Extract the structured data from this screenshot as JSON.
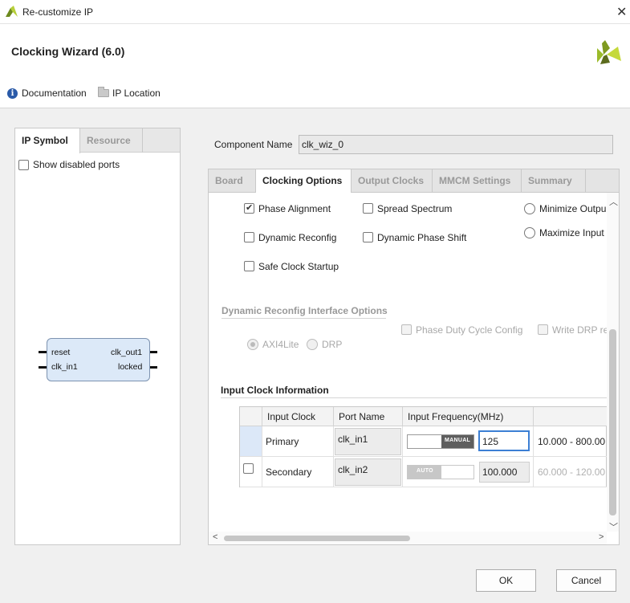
{
  "window": {
    "title": "Re-customize IP",
    "close_glyph": "✕"
  },
  "header": {
    "title": "Clocking Wizard (6.0)",
    "documentation_label": "Documentation",
    "ip_location_label": "IP Location"
  },
  "left_panel": {
    "tabs": [
      {
        "label": "IP Symbol",
        "active": true
      },
      {
        "label": "Resource",
        "active": false
      }
    ],
    "show_disabled_ports": {
      "label": "Show disabled ports",
      "checked": false
    },
    "symbol": {
      "left_ports": [
        "reset",
        "clk_in1"
      ],
      "right_ports": [
        "clk_out1",
        "locked"
      ]
    }
  },
  "component": {
    "label": "Component Name",
    "value": "clk_wiz_0"
  },
  "tabs": [
    {
      "label": "Board",
      "active": false
    },
    {
      "label": "Clocking Options",
      "active": true
    },
    {
      "label": "Output Clocks",
      "active": false
    },
    {
      "label": "MMCM Settings",
      "active": false
    },
    {
      "label": "Summary",
      "active": false
    }
  ],
  "clocking_options": {
    "phase_alignment": {
      "label": "Phase Alignment",
      "checked": true
    },
    "spread_spectrum": {
      "label": "Spread Spectrum",
      "checked": false
    },
    "minimize_output": {
      "label": "Minimize Outpu",
      "selected": false
    },
    "dynamic_reconfig": {
      "label": "Dynamic Reconfig",
      "checked": false
    },
    "dynamic_phase_shift": {
      "label": "Dynamic Phase Shift",
      "checked": false
    },
    "maximize_input": {
      "label": "Maximize Input",
      "selected": false
    },
    "safe_clock_startup": {
      "label": "Safe Clock Startup",
      "checked": false
    }
  },
  "dynamic_reconfig": {
    "title": "Dynamic Reconfig Interface Options",
    "axi4lite": {
      "label": "AXI4Lite",
      "selected": true
    },
    "drp": {
      "label": "DRP",
      "selected": false
    },
    "phase_duty_cycle": {
      "label": "Phase Duty Cycle Config",
      "checked": false
    },
    "write_drp": {
      "label": "Write DRP re",
      "checked": false
    }
  },
  "input_clock": {
    "title": "Input Clock Information",
    "headers": [
      "Input Clock",
      "Port Name",
      "Input Frequency(MHz)"
    ],
    "rows": [
      {
        "name": "Primary",
        "port": "clk_in1",
        "mode": "MANUAL",
        "freq": "125",
        "range": "10.000 - 800.00"
      },
      {
        "name": "Secondary",
        "port": "clk_in2",
        "mode": "AUTO",
        "freq": "100.000",
        "range": "60.000 - 120.00"
      }
    ]
  },
  "buttons": {
    "ok": "OK",
    "cancel": "Cancel"
  },
  "colors": {
    "logo_green": "#9bbb2a",
    "logo_dark": "#5c6b1e",
    "info_blue": "#2a5aa8",
    "focus_blue": "#3c7fd4"
  }
}
